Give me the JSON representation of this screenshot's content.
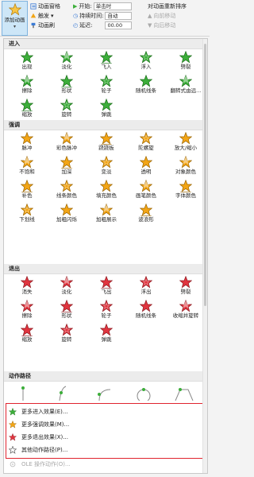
{
  "ribbon": {
    "add_animation": "添加动画",
    "animation_pane": "动画窗格",
    "trigger": "触发",
    "animation_painter": "动画刷",
    "start_label": "开始:",
    "start_value": "单击时",
    "duration_label": "持续时间:",
    "duration_value": "自动",
    "delay_label": "延迟:",
    "delay_value": "00.00",
    "reorder_title": "对动画重新排序",
    "move_earlier": "向前移动",
    "move_later": "向后移动"
  },
  "sections": {
    "entrance": {
      "title": "进入",
      "items": [
        "出现",
        "淡化",
        "飞入",
        "浮入",
        "劈裂",
        "擦除",
        "形状",
        "轮子",
        "随机线条",
        "翻转式由远...",
        "缩放",
        "旋转",
        "弹跳"
      ]
    },
    "emphasis": {
      "title": "强调",
      "items": [
        "脉冲",
        "彩色脉冲",
        "跷跷板",
        "陀螺旋",
        "放大/缩小",
        "不饱和",
        "加深",
        "变淡",
        "透明",
        "对象颜色",
        "补色",
        "线条颜色",
        "填充颜色",
        "画笔颜色",
        "字体颜色",
        "下划线",
        "加粗闪烁",
        "加粗展示",
        "波浪形"
      ]
    },
    "exit": {
      "title": "退出",
      "items": [
        "消失",
        "淡化",
        "飞出",
        "浮出",
        "劈裂",
        "擦除",
        "形状",
        "轮子",
        "随机线条",
        "收缩并旋转",
        "缩放",
        "旋转",
        "弹跳"
      ]
    },
    "motion": {
      "title": "动作路径"
    }
  },
  "menu": {
    "more_entrance": "更多进入效果(E)...",
    "more_emphasis": "更多强调效果(M)...",
    "more_exit": "更多退出效果(X)...",
    "other_motion": "其他动作路径(P)...",
    "ole_verbs": "OLE 操作动作(O)..."
  },
  "colors": {
    "entrance": "#3cae3a",
    "emphasis": "#f2a516",
    "exit": "#e0353f",
    "highlight": "#e0242f"
  }
}
